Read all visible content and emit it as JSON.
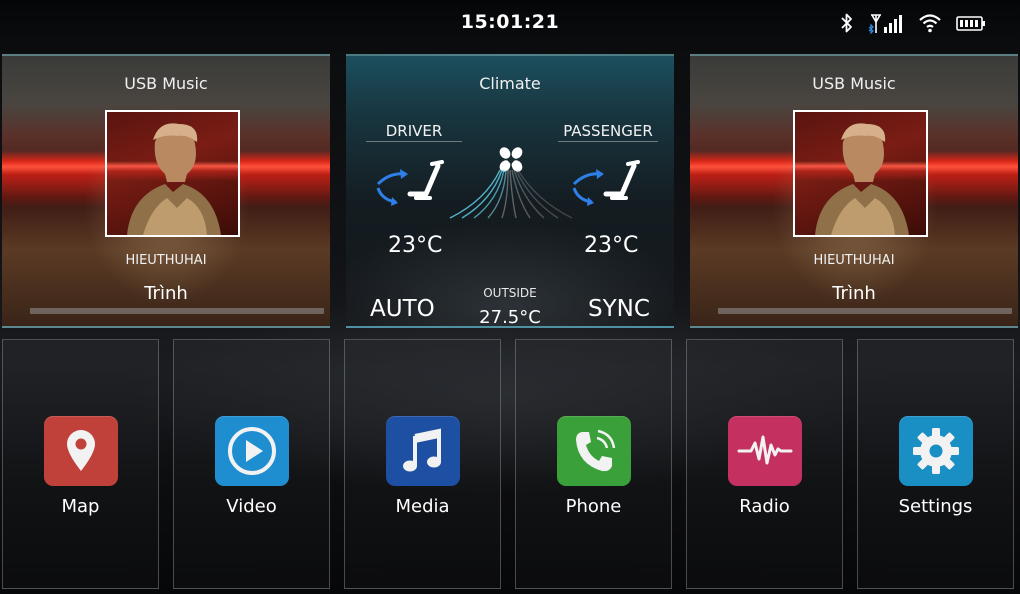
{
  "status_bar": {
    "time": "15:01:21",
    "icons": [
      "bluetooth-icon",
      "signal-icon",
      "wifi-icon",
      "battery-icon"
    ]
  },
  "music_left": {
    "title": "USB Music",
    "artist": "HIEUTHUHAI",
    "song": "Trình",
    "progress": 0.0
  },
  "climate": {
    "title": "Climate",
    "driver_label": "DRIVER",
    "passenger_label": "PASSENGER",
    "driver_temp": "23°C",
    "passenger_temp": "23°C",
    "auto_label": "AUTO",
    "sync_label": "SYNC",
    "outside_label": "OUTSIDE",
    "outside_temp": "27.5°C",
    "icons": [
      "seat-airflow-icon",
      "fan-icon"
    ]
  },
  "music_right": {
    "title": "USB Music",
    "artist": "HIEUTHUHAI",
    "song": "Trình",
    "progress": 0.0
  },
  "apps": [
    {
      "label": "Map",
      "icon": "map-pin-icon",
      "color": "#c0403a"
    },
    {
      "label": "Video",
      "icon": "play-icon",
      "color": "#1e8ed0"
    },
    {
      "label": "Media",
      "icon": "music-note-icon",
      "color": "#1d4fa3"
    },
    {
      "label": "Phone",
      "icon": "phone-icon",
      "color": "#3aa03a"
    },
    {
      "label": "Radio",
      "icon": "waveform-icon",
      "color": "#c4305f"
    },
    {
      "label": "Settings",
      "icon": "gear-icon",
      "color": "#1a8fc4"
    }
  ],
  "colors": {
    "accent_airflow": "#2e7fe8",
    "tile_border": "#78c8d7"
  }
}
